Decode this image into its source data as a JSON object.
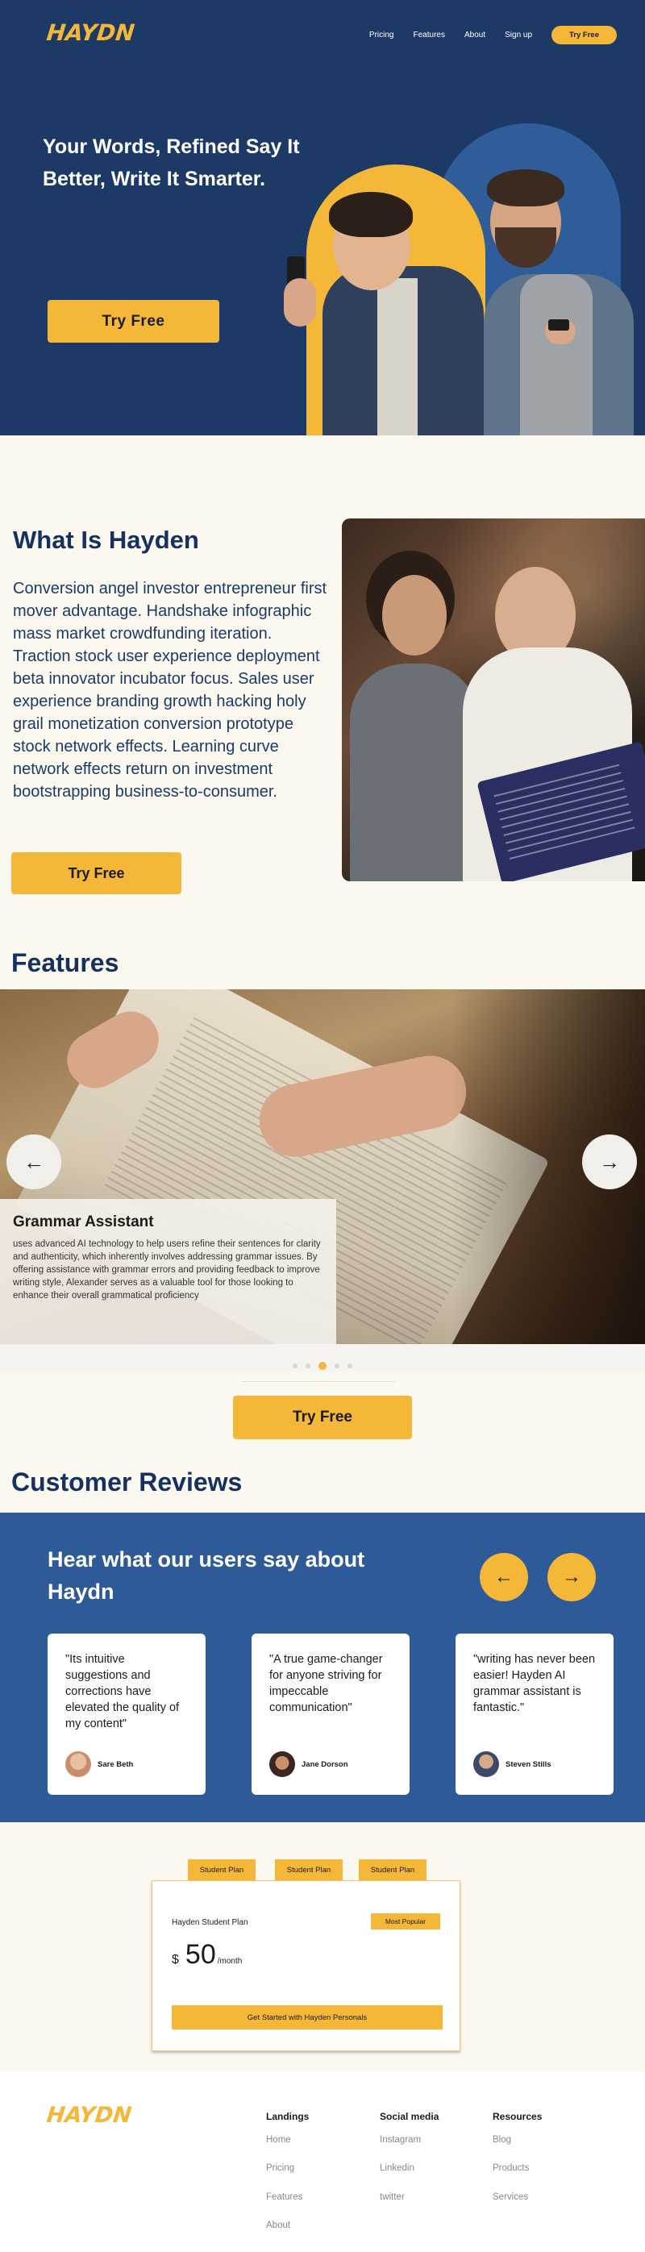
{
  "brand": {
    "logo_text": "HAYDN",
    "accent": "#f4b738",
    "navy": "#1d3a66",
    "blue": "#2e5b97"
  },
  "nav": {
    "items": [
      "Pricing",
      "Features",
      "About",
      "Sign up"
    ],
    "cta": "Try Free"
  },
  "hero": {
    "title": "Your Words, Refined Say It Better, Write It Smarter.",
    "cta": "Try  Free"
  },
  "what": {
    "title": "What Is Hayden",
    "body": "Conversion angel investor entrepreneur first mover advantage. Handshake infographic mass market crowdfunding iteration. Traction stock user experience deployment beta innovator incubator focus. Sales user experience branding growth hacking holy grail monetization conversion prototype stock network effects. Learning curve network effects return on investment bootstrapping business-to-consumer.",
    "cta": "Try  Free"
  },
  "features": {
    "title": "Features",
    "slide": {
      "title": "Grammar Assistant",
      "text": "uses advanced AI technology to help users refine their sentences for clarity and authenticity, which inherently involves addressing grammar issues. By offering assistance with grammar errors and providing feedback to improve writing style, Alexander serves as a valuable tool for those looking to enhance their overall grammatical proficiency"
    },
    "prev_icon": "arrow-left-icon",
    "next_icon": "arrow-right-icon",
    "dots": 5,
    "active_dot": 3,
    "cta": "Try  Free"
  },
  "reviews": {
    "title": "Customer Reviews",
    "heading": "Hear what our users say about Haydn",
    "items": [
      {
        "quote": "\"Its intuitive suggestions and corrections have elevated the quality of my content\"",
        "name": "Sare Beth"
      },
      {
        "quote": "\"A true game-changer for anyone striving for impeccable communication\"",
        "name": "Jane Dorson"
      },
      {
        "quote": "\"writing has never been easier! Hayden AI grammar assistant   is fantastic.\"",
        "name": "Steven Stills"
      }
    ]
  },
  "pricing": {
    "tabs": [
      "Student Plan",
      "Student Plan",
      "Student Plan"
    ],
    "plan_name": "Hayden Student Plan",
    "badge": "Most Popular",
    "currency": "$",
    "amount": "50",
    "period": "/month",
    "cta": "Get Started with Hayden Personals"
  },
  "footer": {
    "logo_text": "HAYDN",
    "columns": [
      {
        "title": "Landings",
        "links": [
          "Home",
          "Pricing",
          "Features",
          "About"
        ]
      },
      {
        "title": "Social media",
        "links": [
          "Instagram",
          "Linkedin",
          "twitter"
        ]
      },
      {
        "title": "Resources",
        "links": [
          "Blog",
          "Products",
          "Services"
        ]
      }
    ]
  }
}
